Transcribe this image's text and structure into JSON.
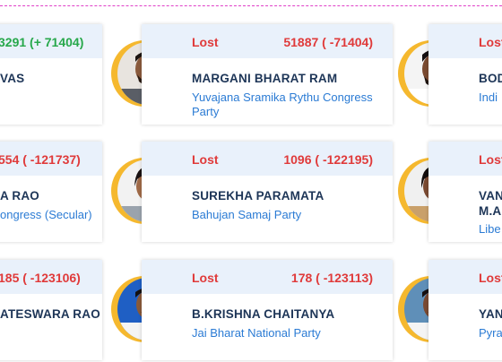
{
  "cards": [
    {
      "status": "",
      "votes": "3291 (+ 71404)",
      "name": "VAS",
      "party": ""
    },
    {
      "status": "Lost",
      "votes": "51887 ( -71404)",
      "name": "MARGANI BHARAT RAM",
      "party_line1": "Yuvajana Sramika Rythu Congress",
      "party_line2": "Party"
    },
    {
      "status": "Lost",
      "votes": "",
      "name": "BOD",
      "party": "Indi"
    },
    {
      "status": "",
      "votes": "554 ( -121737)",
      "name": "A RAO",
      "party": "ongress (Secular)"
    },
    {
      "status": "Lost",
      "votes": "1096 ( -122195)",
      "name": "SUREKHA PARAMATA",
      "party": "Bahujan Samaj Party"
    },
    {
      "status": "Lost",
      "votes": "",
      "name_line1": "VAN",
      "name_line2": "M.A",
      "party": "Libe"
    },
    {
      "status": "",
      "votes": "185 ( -123106)",
      "name": "ATESWARA RAO",
      "party": ""
    },
    {
      "status": "Lost",
      "votes": "178 ( -123113)",
      "name": "B.KRISHNA CHAITANYA",
      "party": "Jai Bharat National Party"
    },
    {
      "status": "Lost",
      "votes": "",
      "name": "YAN",
      "party": "Pyra"
    }
  ],
  "colors": {
    "lost": "#e03a3a",
    "won": "#27a84b",
    "name": "#1d3557",
    "party": "#2b7bd4",
    "ring": "#f5b82e",
    "header_bg": "#e9f1fb"
  },
  "icons": [
    "candidate-photo"
  ]
}
